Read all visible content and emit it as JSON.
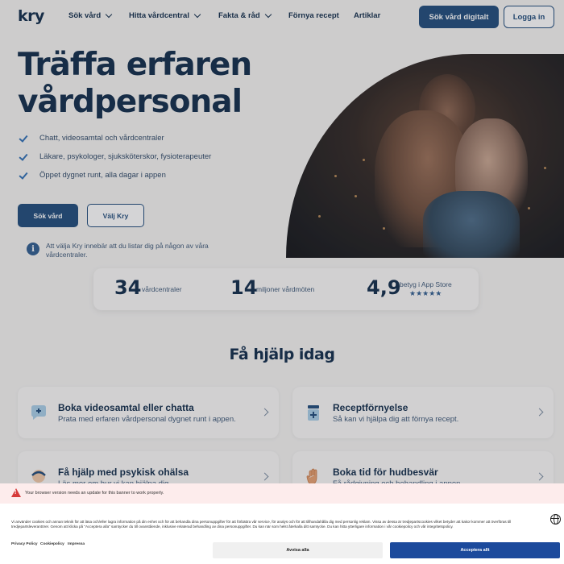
{
  "nav": {
    "logo": "kry",
    "items": [
      "Sök vård",
      "Hitta vårdcentral",
      "Fakta & råd",
      "Förnya recept",
      "Artiklar"
    ],
    "primary_button": "Sök vård digitalt",
    "login_button": "Logga in"
  },
  "hero": {
    "title": "Träffa erfaren vårdpersonal",
    "checks": [
      "Chatt, videosamtal och vårdcentraler",
      "Läkare, psykologer, sjuksköterskor, fysioterapeuter",
      "Öppet dygnet runt, alla dagar i appen"
    ],
    "btn_primary": "Sök vård",
    "btn_secondary": "Välj Kry",
    "info_text": "Att välja Kry innebär att du listar dig på någon av våra vårdcentraler."
  },
  "stats": [
    {
      "number": "34",
      "label": "vårdcentraler"
    },
    {
      "number": "14",
      "label": "miljoner vårdmöten"
    },
    {
      "number": "4,9",
      "label": "betyg i App Store"
    }
  ],
  "stars": "★★★★★",
  "section": {
    "title": "Få hjälp idag",
    "cards": [
      {
        "title": "Boka videosamtal eller chatta",
        "desc": "Prata med erfaren vårdpersonal dygnet runt i appen.",
        "icon": "chat-bubble-plus-icon"
      },
      {
        "title": "Receptförnyelse",
        "desc": "Så kan vi hjälpa dig att förnya recept.",
        "icon": "prescription-icon"
      },
      {
        "title": "Få hjälp med psykisk ohälsa",
        "desc": "Läs mer om hur vi kan hjälpa dig.",
        "icon": "head-icon"
      },
      {
        "title": "Boka tid för hudbesvär",
        "desc": "Få rådgivning och behandling i appen.",
        "icon": "hand-icon"
      }
    ]
  },
  "cookie": {
    "warning": "Your browser version needs an update for this banner to work properly.",
    "text": "Vi använder cookies och annan teknik för att läsa och/eller lagra information på din enhet och för att behandla dina personuppgifter för att förbättra vår service, för analys och för att tillhandahålla dig med personlig reklam. Vissa av dessa är tredjepartscookies vilket betyder att kakor kommer att överföras till tredjepartsleverantörer. Genom att klicka på \"Acceptera alla\" samtycker du till ovanstående, inklusive relaterad behandling av dina personuppgifter. Du kan när som helst återkalla ditt samtycke. Du kan hitta ytterligare information i vår cookiepolicy och vår integritetspolicy.",
    "links": [
      "Privacy Policy",
      "Cookiepolicy",
      "Impressa"
    ],
    "reject": "Avvisa alla",
    "accept": "Acceptera allt"
  },
  "colors": {
    "primary": "#1d4a7a",
    "text": "#0e2a48",
    "accept": "#1c4a9c",
    "warning": "#d63a3a"
  }
}
